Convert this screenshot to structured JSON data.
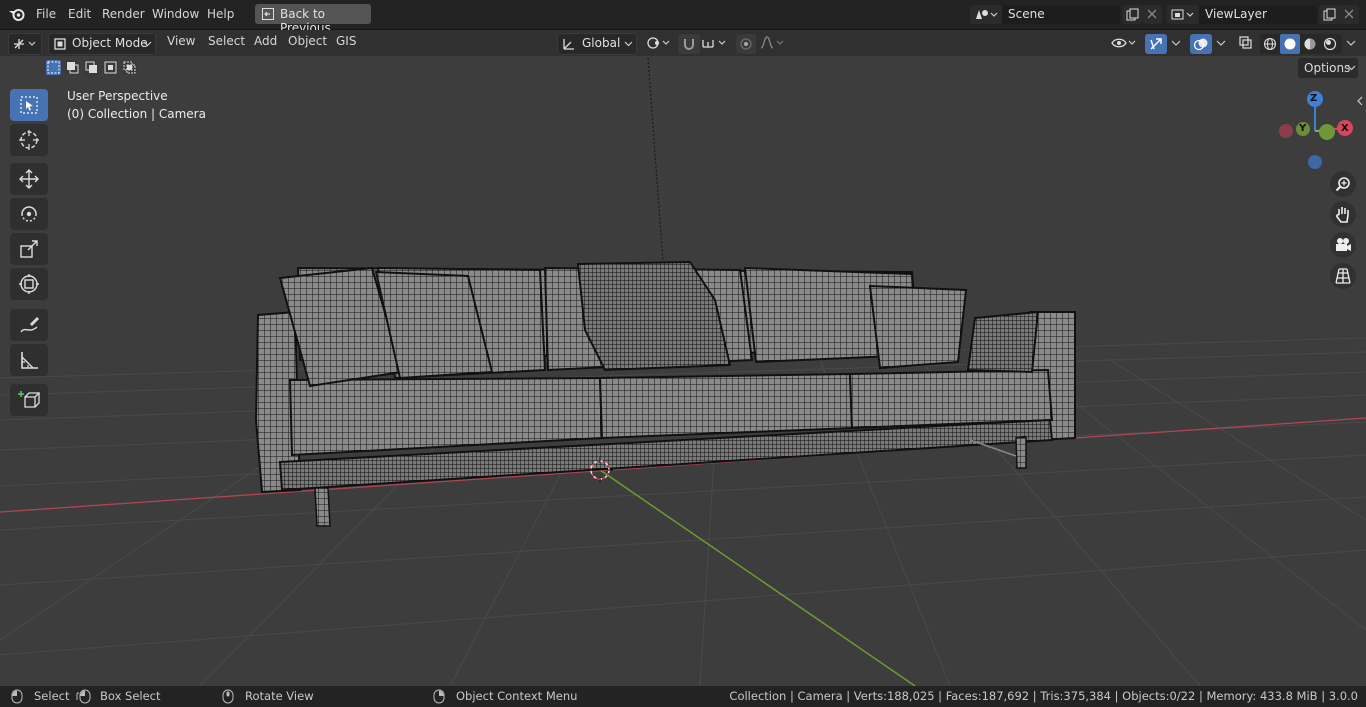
{
  "app": "Blender",
  "topbar": {
    "menu": [
      "File",
      "Edit",
      "Render",
      "Window",
      "Help"
    ],
    "back_button": "Back to Previous",
    "scene_field": "Scene",
    "view_layer_field": "ViewLayer"
  },
  "header": {
    "editor_type_icon": "3d-viewport-icon",
    "mode": "Object Mode",
    "menus": [
      "View",
      "Select",
      "Add",
      "Object",
      "GIS"
    ],
    "transform_orientation": "Global",
    "options_label": "Options"
  },
  "viewport": {
    "perspective_label": "User Perspective",
    "collection_label": "(0) Collection | Camera",
    "gizmo_axes": {
      "z": "Z",
      "y": "Y",
      "x": "X"
    }
  },
  "toolbar": {
    "tools": [
      "select-box",
      "cursor",
      "move",
      "rotate",
      "scale",
      "transform",
      "annotate",
      "measure",
      "add-cube"
    ],
    "active_tool": "select-box"
  },
  "nav_gizmos": [
    "zoom-icon",
    "hand-icon",
    "camera-icon",
    "grid-icon"
  ],
  "statusbar": {
    "left": [
      {
        "icon": "mouse-left-icon",
        "label": "Select"
      },
      {
        "icon": "mouse-drag-icon",
        "label": "Box Select"
      },
      {
        "icon": "mouse-middle-icon",
        "label": "Rotate View"
      },
      {
        "icon": "mouse-right-icon",
        "label": "Object Context Menu"
      }
    ],
    "stats": "Collection | Camera | Verts:188,025 | Faces:187,692 | Tris:375,384 | Objects:0/22 | Memory: 433.8 MiB | 3.0.0"
  },
  "colors": {
    "accent": "#4772b3",
    "axis_x": "#d9465a",
    "axis_y": "#7fad3b",
    "axis_z": "#3f7fd4",
    "viewport_bg": "#3d3d3d"
  }
}
